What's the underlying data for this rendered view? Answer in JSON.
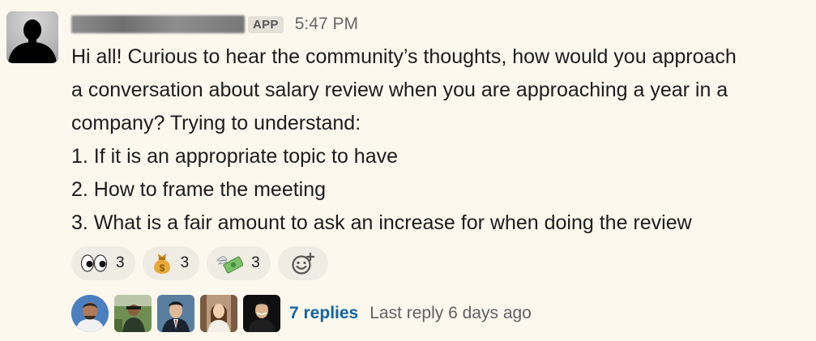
{
  "message": {
    "badge": "APP",
    "time": "5:47 PM",
    "lines": [
      "Hi all! Curious to hear the community’s thoughts, how would you approach",
      "a conversation about salary review when you are approaching a year in a",
      "company? Trying to understand:",
      "1. If it is an appropriate topic to have",
      "2. How to frame the meeting",
      "3. What is a fair amount to ask an increase for when doing the review"
    ]
  },
  "reactions": [
    {
      "icon": "eyes-emoji-icon",
      "count": "3"
    },
    {
      "icon": "money-bag-emoji-icon",
      "count": "3"
    },
    {
      "icon": "money-with-wings-emoji-icon",
      "count": "3"
    }
  ],
  "thread": {
    "replies_label": "7 replies",
    "last_reply": "Last reply 6 days ago"
  },
  "colors": {
    "background": "#fcf8ed",
    "link": "#1264a3",
    "reaction_bg": "#efece4"
  }
}
